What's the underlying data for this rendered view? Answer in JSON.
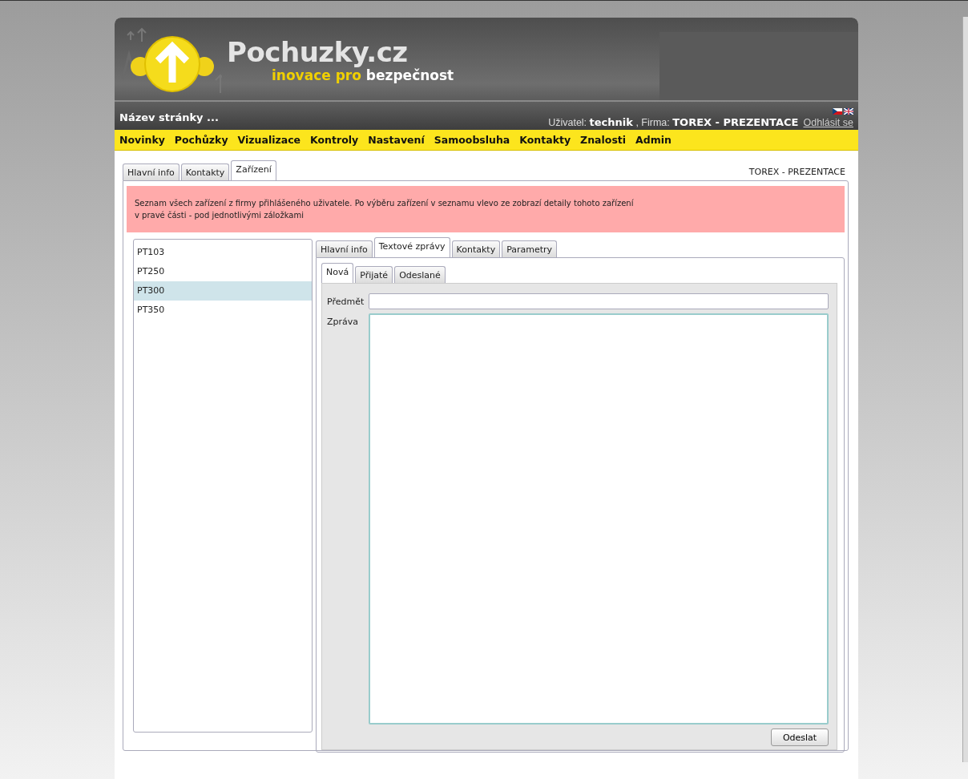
{
  "logo": {
    "name": "Pochuzky.cz",
    "tagline_highlight": "inovace pro",
    "tagline_rest": "bezpečnost"
  },
  "page_title": "Název stránky ...",
  "user_bar": {
    "user_label": "Uživatel:",
    "user": "technik",
    "company_label": ", Firma:",
    "company": "TOREX - PREZENTACE",
    "logout": "Odhlásit se"
  },
  "nav": [
    "Novinky",
    "Pochůzky",
    "Vizualizace",
    "Kontroly",
    "Nastavení",
    "Samoobsluha",
    "Kontakty",
    "Znalosti",
    "Admin"
  ],
  "main_tabs": [
    {
      "label": "Hlavní info",
      "selected": false
    },
    {
      "label": "Kontakty",
      "selected": false
    },
    {
      "label": "Zařízení",
      "selected": true
    }
  ],
  "company_caption": "TOREX - PREZENTACE",
  "info_lines": [
    "Seznam všech zařízení z firmy přihlášeného uživatele. Po výběru zařízení v seznamu vlevo ze zobrazí detaily tohoto zařízení",
    "v pravé části - pod jednotlivými záložkami"
  ],
  "devices": [
    {
      "name": "PT103",
      "selected": false
    },
    {
      "name": "PT250",
      "selected": false
    },
    {
      "name": "PT300",
      "selected": true
    },
    {
      "name": "PT350",
      "selected": false
    }
  ],
  "detail_tabs": [
    {
      "label": "Hlavní info",
      "selected": false
    },
    {
      "label": "Textové zprávy",
      "selected": true
    },
    {
      "label": "Kontakty",
      "selected": false
    },
    {
      "label": "Parametry",
      "selected": false
    }
  ],
  "message_tabs": [
    {
      "label": "Nová",
      "selected": true
    },
    {
      "label": "Přijaté",
      "selected": false
    },
    {
      "label": "Odeslané",
      "selected": false
    }
  ],
  "form": {
    "subject_label": "Předmět",
    "message_label": "Zpráva",
    "send": "Odeslat"
  }
}
